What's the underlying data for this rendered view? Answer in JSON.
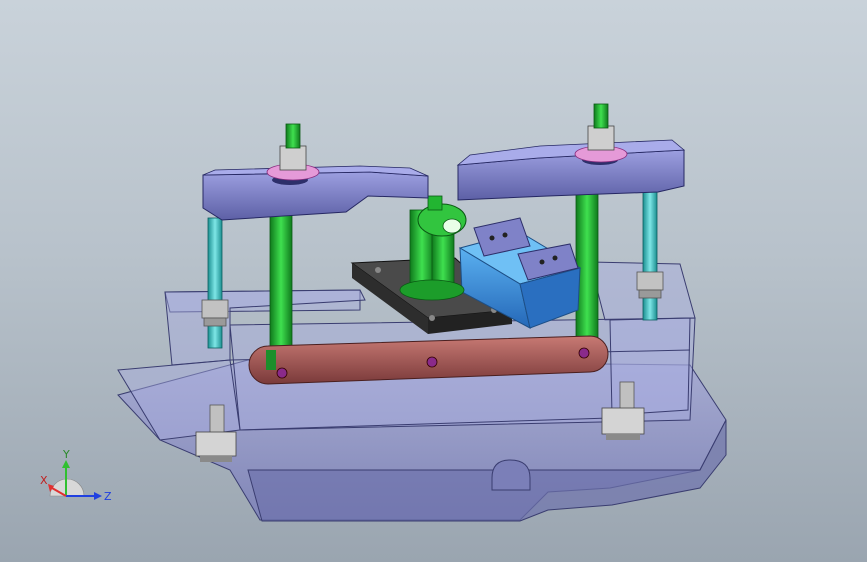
{
  "viewport": {
    "background_top": "#c9d2da",
    "background_bottom": "#9aa5b0"
  },
  "colors": {
    "base_plate": "#8f92c9",
    "housing": "#9ea3d6",
    "clamp_arm": "#7f82c8",
    "rod_green": "#22b531",
    "rod_cyan": "#3fc3c4",
    "washer_pink": "#e59ad8",
    "link_bar": "#b06060",
    "block_blue": "#3c8fd8",
    "plate_dark": "#3a3a3a",
    "nut_gray": "#bfbfbf"
  },
  "triad": {
    "x_label": "X",
    "y_label": "Y",
    "z_label": "Z",
    "x_color": "#e03030",
    "y_color": "#30c030",
    "z_color": "#2040e0"
  }
}
